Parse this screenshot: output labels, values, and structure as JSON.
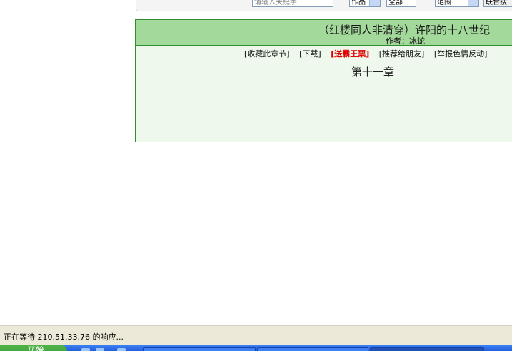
{
  "search": {
    "keyword_placeholder": "请输入关键字",
    "type_value": "作品",
    "filter_value": "全部",
    "range_value": "范围",
    "submit_label": "联合搜"
  },
  "chapter": {
    "book_title": "（红楼同人非清穿）许阳的十八世纪",
    "author": "作者：冰蛇",
    "actions": {
      "bookmark": "[收藏此章节]",
      "download": "[下载]",
      "vote": "[送霸王票]",
      "recommend": "[推荐给朋友]",
      "report": "[举报色情反动]"
    },
    "heading": "第十一章"
  },
  "status": {
    "text": "正在等待 210.51.33.76 的响应..."
  },
  "taskbar": {
    "start_label": "开始"
  },
  "colors": {
    "header_bg": "#a4d99c",
    "body_bg": "#eef8ec",
    "border": "#2f8f2f",
    "vote_red": "#e00000"
  }
}
